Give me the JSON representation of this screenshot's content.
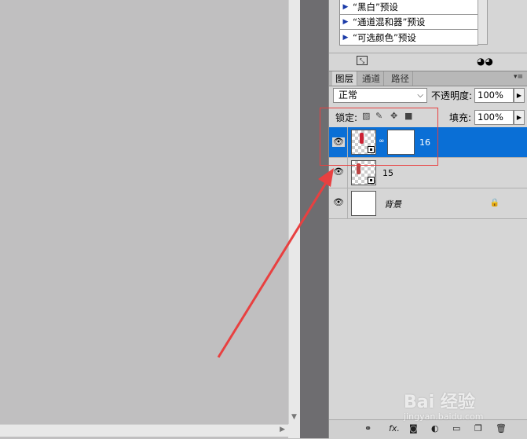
{
  "adjustments_panel": {
    "presets": [
      {
        "label": "“黑白”预设"
      },
      {
        "label": "“通道混和器”预设"
      },
      {
        "label": "“可选颜色”预设"
      }
    ]
  },
  "layers_panel": {
    "tabs": [
      {
        "label": "图层"
      },
      {
        "label": "通道"
      },
      {
        "label": "路径"
      }
    ],
    "blend_mode": "正常",
    "opacity_label": "不透明度:",
    "opacity_value": "100%",
    "lock_label": "锁定:",
    "fill_label": "填充:",
    "fill_value": "100%",
    "layers": [
      {
        "name": "16",
        "selected": true,
        "has_mask": true,
        "smart_object": true
      },
      {
        "name": "15",
        "selected": false,
        "has_mask": false,
        "smart_object": true
      },
      {
        "name": "背景",
        "selected": false,
        "locked": true
      }
    ],
    "footer_fx": "fx."
  },
  "watermark": {
    "text": "Bai 经验",
    "sub": "jingyan.baidu.com"
  },
  "colors": {
    "selection": "#0a6fd6",
    "annotation": "#e84040"
  }
}
